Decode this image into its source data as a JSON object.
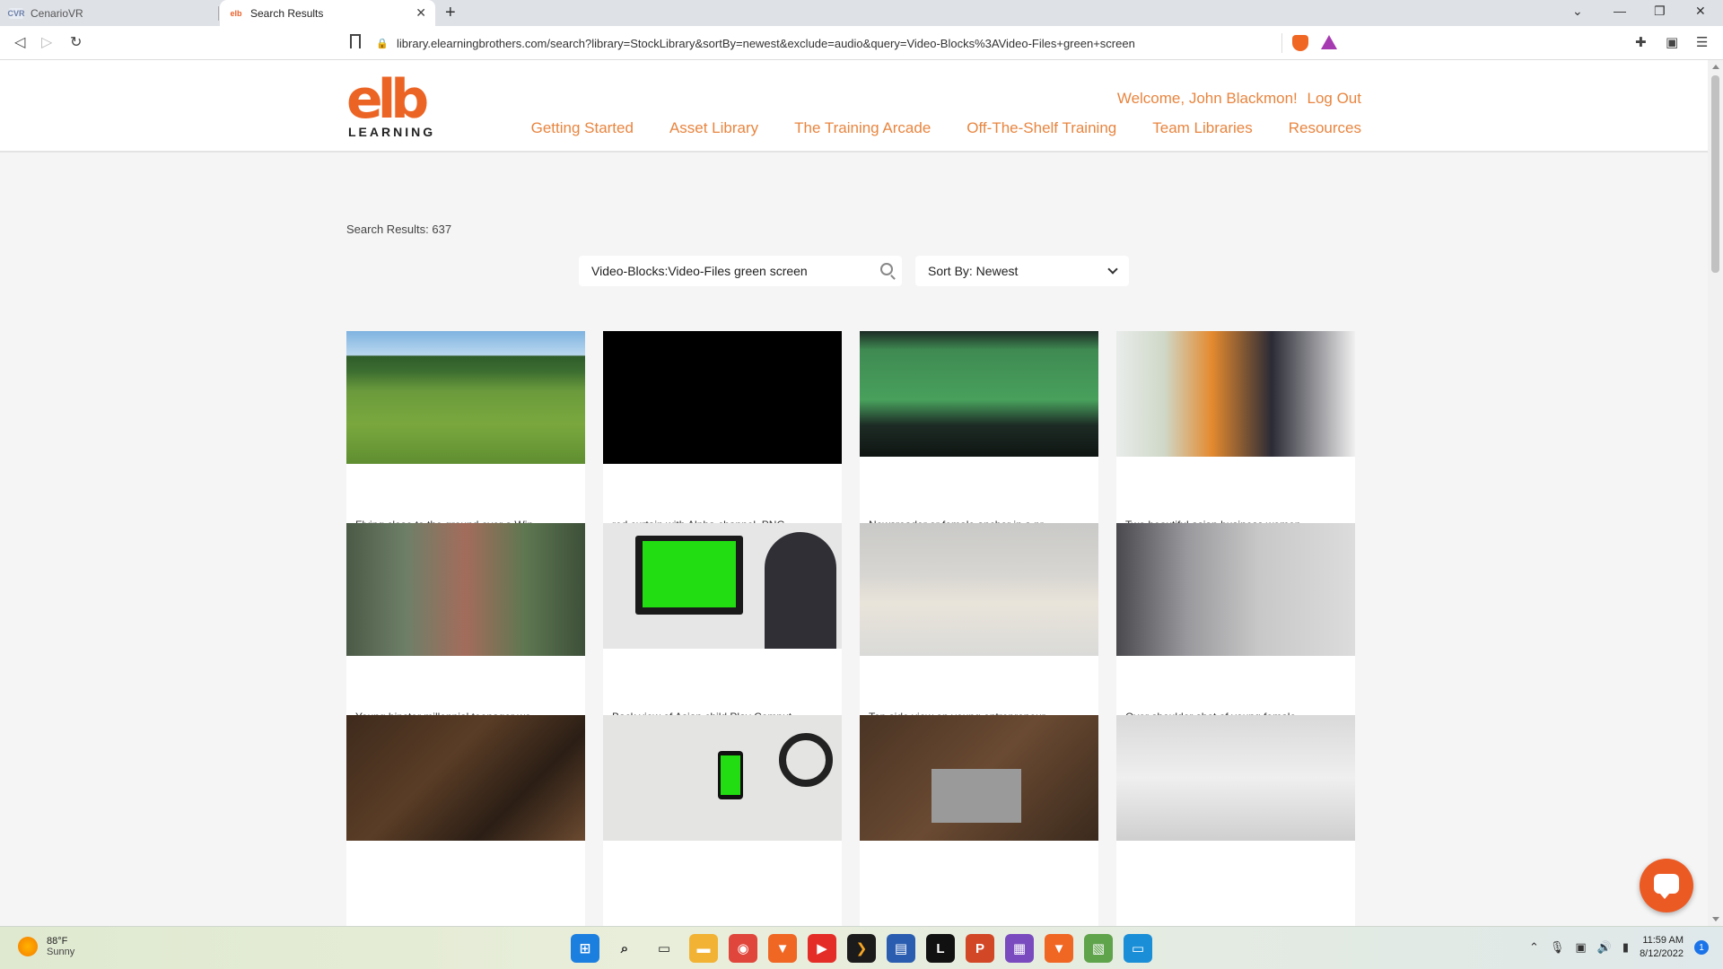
{
  "browser": {
    "tabs": [
      {
        "label": "CenarioVR",
        "favicon": "CVR"
      },
      {
        "label": "Search Results",
        "favicon": "elb"
      }
    ],
    "url": "library.elearningbrothers.com/search?library=StockLibrary&sortBy=newest&exclude=audio&query=Video-Blocks%3AVideo-Files+green+screen"
  },
  "header": {
    "logo_mark": "elb",
    "logo_word": "LEARNING",
    "welcome": "Welcome, John Blackmon!",
    "logout": "Log Out",
    "nav": [
      "Getting Started",
      "Asset Library",
      "The Training Arcade",
      "Off-The-Shelf Training",
      "Team Libraries",
      "Resources"
    ]
  },
  "search": {
    "results_label": "Search Results: 637",
    "query": "Video-Blocks:Video-Files green screen",
    "sort_label": "Sort By: Newest"
  },
  "cards": [
    {
      "title": "Flying close to the ground over a Win..."
    },
    {
      "title": "red curtain with Alpha channel. PNG"
    },
    {
      "title": "Newsreader or female anchor in a pr..."
    },
    {
      "title": "Two beautiful asian business women ..."
    },
    {
      "title": "Young hipster millennial teenager wo..."
    },
    {
      "title": "Back view of Asian child Play Comput..."
    },
    {
      "title": "Top side view on young entrepreneur..."
    },
    {
      "title": "Over shoulder shot of young female ..."
    },
    {
      "title": ""
    },
    {
      "title": ""
    },
    {
      "title": ""
    },
    {
      "title": ""
    }
  ],
  "taskbar": {
    "temp": "88°F",
    "weather": "Sunny",
    "time": "11:59 AM",
    "date": "8/12/2022",
    "notifications": "1"
  },
  "colors": {
    "brand": "#ec6424",
    "nav_text": "#e8853f"
  }
}
